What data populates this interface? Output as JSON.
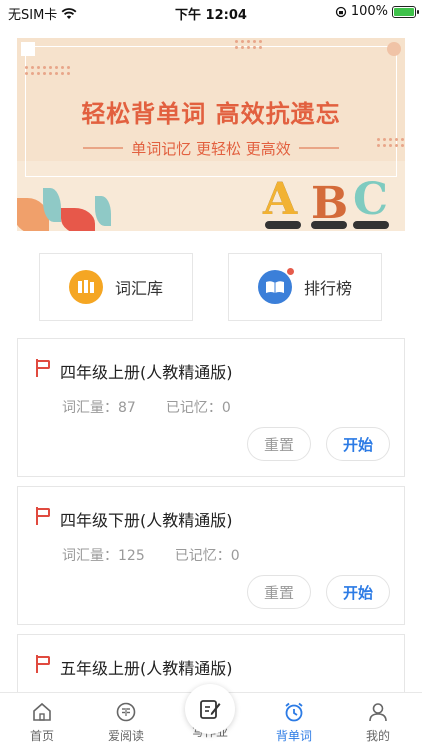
{
  "status_bar": {
    "carrier": "无SIM卡",
    "time": "下午 12:04",
    "battery": "100%",
    "battery_level": 1.0
  },
  "banner": {
    "title": "轻松背单词  高效抗遗忘",
    "subtitle": "单词记忆  更轻松  更高效",
    "letters": [
      "A",
      "B",
      "C"
    ]
  },
  "quick_links": [
    {
      "label": "词汇库",
      "icon": "book-stack-icon",
      "color": "#f5a623"
    },
    {
      "label": "排行榜",
      "icon": "open-book-icon",
      "color": "#3b7fd9",
      "has_badge": true
    }
  ],
  "books": [
    {
      "title": "四年级上册(人教精通版)",
      "vocab_label": "词汇量：",
      "vocab": "87",
      "memorized_label": "已记忆：",
      "memorized": "0",
      "reset": "重置",
      "start": "开始"
    },
    {
      "title": "四年级下册(人教精通版)",
      "vocab_label": "词汇量：",
      "vocab": "125",
      "memorized_label": "已记忆：",
      "memorized": "0",
      "reset": "重置",
      "start": "开始"
    },
    {
      "title": "五年级上册(人教精通版)"
    }
  ],
  "tabs": [
    {
      "label": "首页",
      "icon": "home-icon"
    },
    {
      "label": "爱阅读",
      "icon": "reading-icon"
    },
    {
      "label": "写作业",
      "icon": "homework-icon"
    },
    {
      "label": "背单词",
      "icon": "alarm-clock-icon",
      "active": true
    },
    {
      "label": "我的",
      "icon": "user-icon"
    }
  ],
  "colors": {
    "accent": "#2c7be5",
    "banner_text": "#e2603f",
    "flag": "#e04a3f"
  }
}
